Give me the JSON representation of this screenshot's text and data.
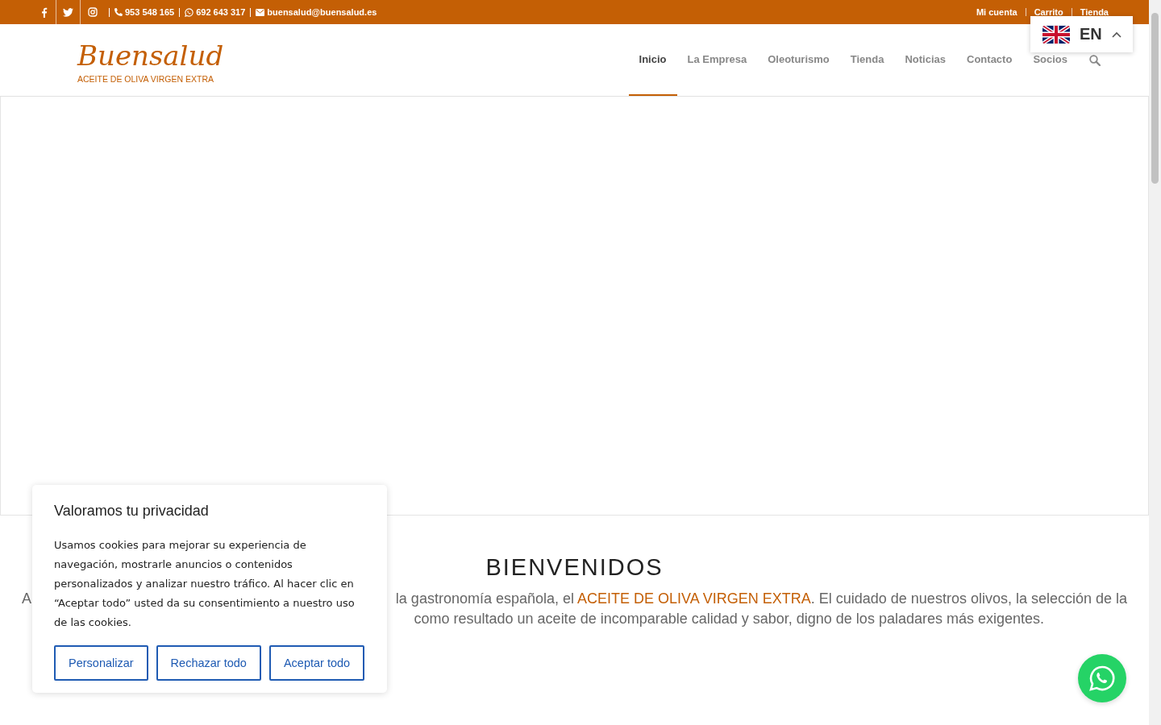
{
  "topbar": {
    "social": [
      {
        "kind": "facebook"
      },
      {
        "kind": "twitter"
      },
      {
        "kind": "instagram"
      }
    ],
    "contacts": [
      {
        "kind": "phone",
        "text": "953 548 165"
      },
      {
        "kind": "whatsapp",
        "text": "692 643 317"
      },
      {
        "kind": "mail",
        "text": "buensalud@buensalud.es"
      }
    ],
    "links": [
      "Mi cuenta",
      "Carrito",
      "Tienda"
    ]
  },
  "logo": {
    "name": "Buensalud",
    "tagline": "ACEITE DE OLIVA VIRGEN EXTRA"
  },
  "nav": [
    {
      "label": "Inicio",
      "selected": true
    },
    {
      "label": "La Empresa",
      "selected": false
    },
    {
      "label": "Oleoturismo",
      "selected": false
    },
    {
      "label": "Tienda",
      "selected": false
    },
    {
      "label": "Noticias",
      "selected": false
    },
    {
      "label": "Contacto",
      "selected": false
    },
    {
      "label": "Socios",
      "selected": false
    }
  ],
  "language": {
    "code": "EN",
    "expanded": true
  },
  "welcome": {
    "title": "BIENVENIDOS",
    "line_1_start": "A",
    "line_1_end": "la gastronomía española, el **ACEITE DE OLIVA VIRGEN EXTRA**. El cuidado de nuestros olivos, la selección de la",
    "line_2_end": "como resultado un aceite de incomparable calidad y sabor, digno de los paladares más exigentes."
  },
  "cookie_dialog": {
    "title": "Valoramos tu privacidad",
    "text": "Usamos cookies para mejorar su experiencia de navegación, mostrarle anuncios o contenidos personalizados y analizar nuestro tráfico. Al hacer clic en “Aceptar todo” usted da su consentimiento a nuestro uso de las cookies.",
    "buttons": [
      "Personalizar",
      "Rechazar todo",
      "Aceptar todo"
    ]
  }
}
